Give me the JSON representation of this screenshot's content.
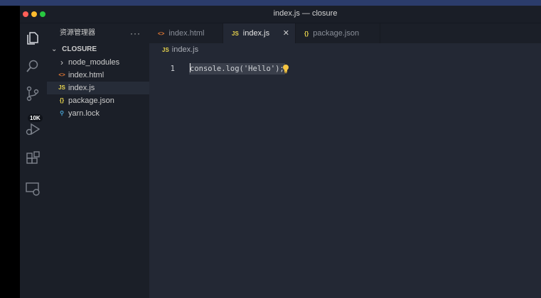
{
  "window": {
    "title": "index.js — closure"
  },
  "activity_bar": {
    "icons": [
      "explorer-icon",
      "search-icon",
      "source-control-icon",
      "run-debug-icon",
      "extensions-icon",
      "remote-explorer-icon"
    ],
    "source_control_badge": "10K"
  },
  "sidebar": {
    "title": "资源管理器",
    "more_label": "···",
    "folder": {
      "label": "CLOSURE",
      "chevron": "⌄"
    },
    "items": [
      {
        "label": "node_modules",
        "icon": "›",
        "icon_name": "chevron-right-icon",
        "color": "#cccccc"
      },
      {
        "label": "index.html",
        "icon": "<>",
        "icon_name": "html-file-icon",
        "color": "#e37933"
      },
      {
        "label": "index.js",
        "icon": "JS",
        "icon_name": "js-file-icon",
        "color": "#e8d44d"
      },
      {
        "label": "package.json",
        "icon": "{}",
        "icon_name": "json-file-icon",
        "color": "#e8d44d"
      },
      {
        "label": "yarn.lock",
        "icon": "⚲",
        "icon_name": "yarn-file-icon",
        "color": "#4aa5d6"
      }
    ]
  },
  "tabs": [
    {
      "label": "index.html",
      "icon": "<>",
      "color": "#e37933"
    },
    {
      "label": "index.js",
      "icon": "JS",
      "color": "#e8d44d",
      "close": "✕"
    },
    {
      "label": "package.json",
      "icon": "{}",
      "color": "#e8d44d"
    }
  ],
  "breadcrumb": {
    "icon": "JS",
    "label": "index.js"
  },
  "editor": {
    "line_number": "1",
    "code": "console.log('Hello');"
  },
  "colors": {
    "editor_bg": "#232834",
    "sidebar_bg": "#1b1f28",
    "accent_js": "#e8d44d",
    "accent_html": "#e37933"
  }
}
